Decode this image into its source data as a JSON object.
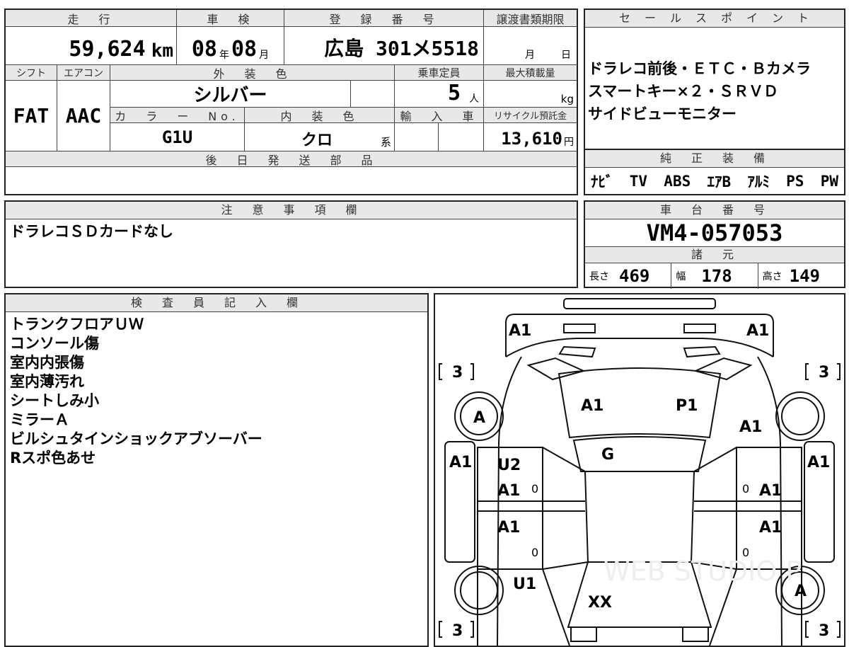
{
  "vehicle": {
    "mileage_header": "走　行",
    "mileage_value": "59,624",
    "mileage_unit": "km",
    "inspection_header": "車　検",
    "inspection_year": "08",
    "inspection_year_unit": "年",
    "inspection_month": "08",
    "inspection_month_unit": "月",
    "registration_header": "登　録　番　号",
    "registration_value": "広島 301メ5518",
    "transfer_header": "譲渡書類期限",
    "transfer_month_unit": "月",
    "transfer_day_unit": "日",
    "shift_header": "シフト",
    "shift_value": "FAT",
    "ac_header": "エアコン",
    "ac_value": "AAC",
    "exterior_color_header": "外　装　色",
    "exterior_color_value": "シルバー",
    "capacity_header": "乗車定員",
    "capacity_value": "5",
    "capacity_unit": "人",
    "max_load_header": "最大積載量",
    "max_load_unit": "kg",
    "color_no_header": "カ　ラ　ー　No.",
    "color_no_value": "G1U",
    "interior_color_header": "内　装　色",
    "interior_color_value": "クロ",
    "interior_color_suffix": "系",
    "import_header": "輸　入　車",
    "recycle_header": "リサイクル預託金",
    "recycle_value": "13,610",
    "recycle_unit": "円",
    "later_parts_header": "後　日　発　送　部　品"
  },
  "sales_points": {
    "header": "セ　ー　ル　ス　ポ　イ　ン　ト",
    "lines": [
      "ドラレコ前後・ＥＴＣ・Ｂカメラ",
      "スマートキー×２・ＳＲＶＤ",
      "サイドビューモニター"
    ]
  },
  "equipment": {
    "header": "純　正　装　備",
    "items": [
      "ﾅﾋﾞ",
      "TV",
      "ABS",
      "ｴｱB",
      "ｱﾙﾐ",
      "PS",
      "PW"
    ]
  },
  "notes": {
    "header": "注　意　事　項　欄",
    "text": "ドラレコＳＤカードなし"
  },
  "chassis": {
    "header": "車　台　番　号",
    "value": "VM4-057053",
    "spec_header": "諸　元",
    "length_label": "長さ",
    "length_value": "469",
    "width_label": "幅",
    "width_value": "178",
    "height_label": "高さ",
    "height_value": "149"
  },
  "inspector": {
    "header": "検　査　員　記　入　欄",
    "lines": [
      "トランクフロアＵＷ",
      "コンソール傷",
      "室内内張傷",
      "室内薄汚れ",
      "シートしみ小",
      "ミラーＡ",
      "ビルシュタインショックアブソーバー",
      "Rスポ色あせ"
    ]
  },
  "diagram": {
    "marks": {
      "rear_left": "A1",
      "rear_right": "A1",
      "tire_rl_grade": "3",
      "tire_rr_grade": "3",
      "tire_fl_grade": "3",
      "tire_fr_grade": "3",
      "wheel_rl": "A",
      "wheel_fr": "A",
      "trunk_left": "A1",
      "trunk_right": "P1",
      "quarter_right": "A1",
      "roof": "G",
      "side_left": "A1",
      "side_right": "A1",
      "rear_door_left_top": "U2",
      "rear_door_left": "A1",
      "rear_door_right": "A1",
      "front_door_left": "A1",
      "front_door_right": "A1",
      "fender_left": "U1",
      "hood": "XX",
      "door_zero": "0"
    },
    "watermark": "WEB STUDIO P"
  }
}
